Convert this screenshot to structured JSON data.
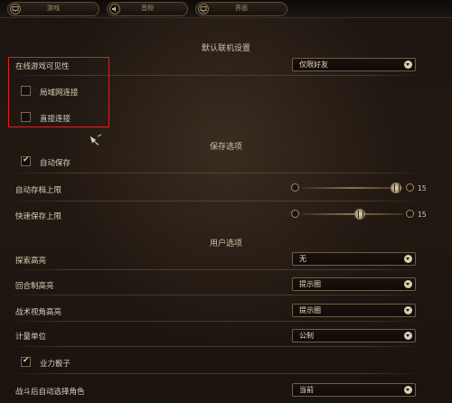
{
  "tabs": [
    {
      "label": "游戏",
      "icon": "monitor-icon"
    },
    {
      "label": "音频",
      "icon": "speaker-icon"
    },
    {
      "label": "界面",
      "icon": "display-icon"
    }
  ],
  "online": {
    "title": "默认联机设置",
    "visibility_label": "在线游戏可见性",
    "visibility_value": "仅限好友",
    "lan_label": "局域网连接",
    "lan_checked": false,
    "direct_label": "直接连接",
    "direct_checked": false
  },
  "save": {
    "title": "保存选项",
    "autosave_label": "自动保存",
    "autosave_checked": true,
    "autosave_limit_label": "自动存档上限",
    "autosave_limit_value": "15",
    "quicksave_limit_label": "快速保存上限",
    "quicksave_limit_value": "15"
  },
  "user": {
    "title": "用户选项",
    "explore_label": "探索高亮",
    "explore_value": "无",
    "turn_label": "回合制高亮",
    "turn_value": "提示圈",
    "tactical_label": "战术视角高亮",
    "tactical_value": "提示圈",
    "units_label": "计量单位",
    "units_value": "公制",
    "karmic_label": "业力骰子",
    "karmic_checked": true,
    "combat_label": "战斗后自动选择角色",
    "combat_value": "当前"
  },
  "colors": {
    "highlight_box": "#e02020",
    "accent": "#d9cdb2"
  }
}
